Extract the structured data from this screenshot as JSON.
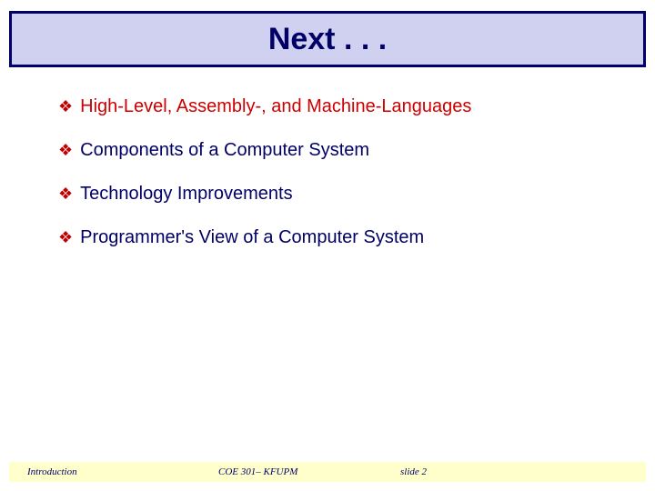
{
  "title": "Next . . .",
  "bullets": [
    {
      "text": "High-Level, Assembly-, and Machine-Languages",
      "highlight": true
    },
    {
      "text": "Components of a Computer System",
      "highlight": false
    },
    {
      "text": "Technology Improvements",
      "highlight": false
    },
    {
      "text": "Programmer's View of a Computer System",
      "highlight": false
    }
  ],
  "footer": {
    "left": "Introduction",
    "center": "COE 301– KFUPM",
    "right": "slide 2"
  }
}
